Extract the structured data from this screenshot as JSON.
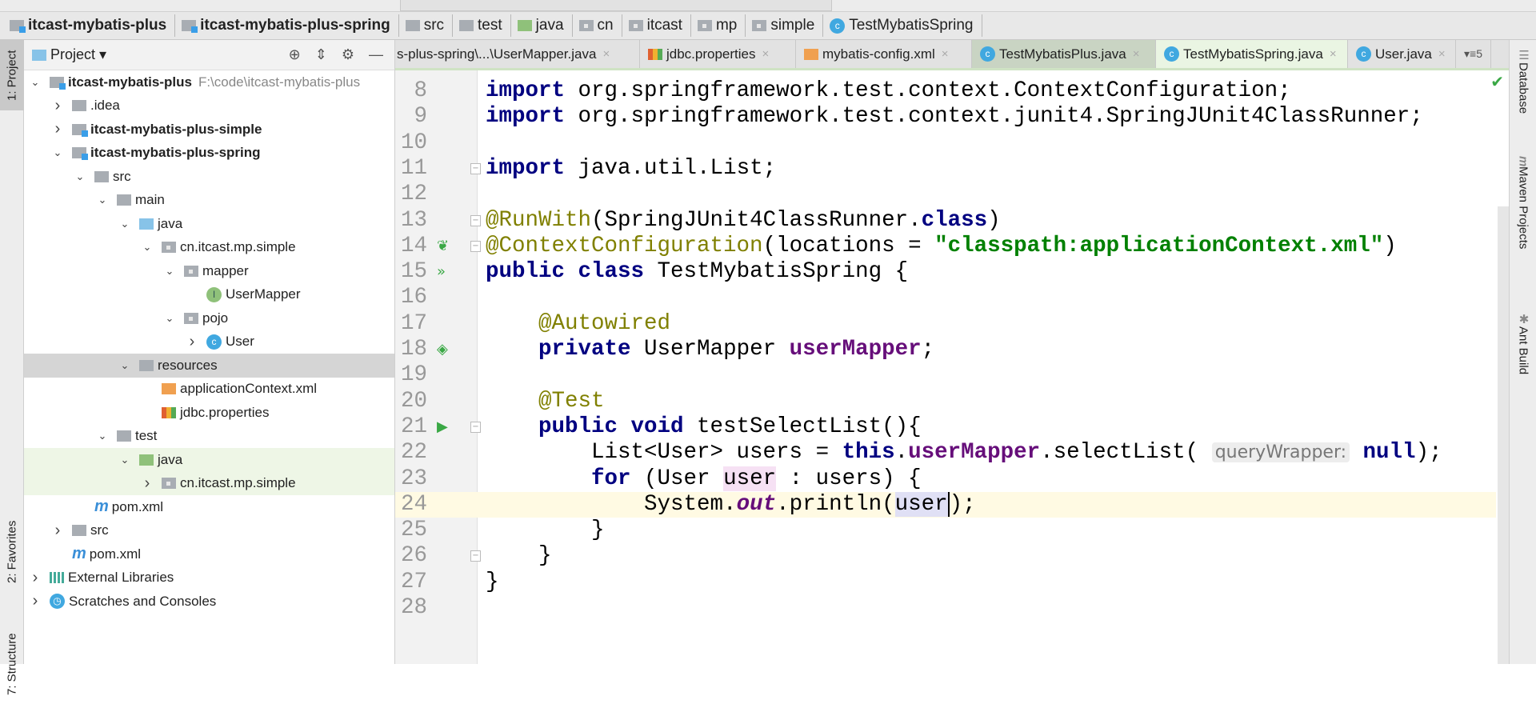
{
  "breadcrumb": [
    {
      "label": "itcast-mybatis-plus",
      "icon": "module-icon",
      "bold": true
    },
    {
      "label": "itcast-mybatis-plus-spring",
      "icon": "module-icon",
      "bold": true
    },
    {
      "label": "src",
      "icon": "folder-icon"
    },
    {
      "label": "test",
      "icon": "folder-icon"
    },
    {
      "label": "java",
      "icon": "test-folder-icon"
    },
    {
      "label": "cn",
      "icon": "package-icon"
    },
    {
      "label": "itcast",
      "icon": "package-icon"
    },
    {
      "label": "mp",
      "icon": "package-icon"
    },
    {
      "label": "simple",
      "icon": "package-icon"
    },
    {
      "label": "TestMybatisSpring",
      "icon": "class-icon"
    }
  ],
  "left_strip": {
    "project": "1: Project",
    "favorites": "2: Favorites",
    "structure": "7: Structure"
  },
  "right_strip": {
    "database": "Database",
    "maven": "Maven Projects",
    "ant": "Ant Build"
  },
  "project_panel": {
    "title": "Project ▾",
    "tree": [
      {
        "level": 0,
        "arrow": "v",
        "icon": "module",
        "label": "itcast-mybatis-plus",
        "bold": true,
        "path": "F:\\code\\itcast-mybatis-plus"
      },
      {
        "level": 1,
        "arrow": ">",
        "icon": "folder",
        "label": ".idea"
      },
      {
        "level": 1,
        "arrow": ">",
        "icon": "module",
        "label": "itcast-mybatis-plus-simple",
        "bold": true
      },
      {
        "level": 1,
        "arrow": "v",
        "icon": "module",
        "label": "itcast-mybatis-plus-spring",
        "bold": true
      },
      {
        "level": 2,
        "arrow": "v",
        "icon": "folder",
        "label": "src"
      },
      {
        "level": 3,
        "arrow": "v",
        "icon": "folder",
        "label": "main"
      },
      {
        "level": 4,
        "arrow": "v",
        "icon": "source",
        "label": "java"
      },
      {
        "level": 5,
        "arrow": "v",
        "icon": "package",
        "label": "cn.itcast.mp.simple"
      },
      {
        "level": 6,
        "arrow": "v",
        "icon": "package",
        "label": "mapper"
      },
      {
        "level": 7,
        "arrow": "",
        "icon": "interface",
        "label": "UserMapper"
      },
      {
        "level": 6,
        "arrow": "v",
        "icon": "package",
        "label": "pojo"
      },
      {
        "level": 7,
        "arrow": ">",
        "icon": "class",
        "label": "User"
      },
      {
        "level": 4,
        "arrow": "v",
        "icon": "resources",
        "label": "resources",
        "highlight": "gray"
      },
      {
        "level": 5,
        "arrow": "",
        "icon": "xml",
        "label": "applicationContext.xml"
      },
      {
        "level": 5,
        "arrow": "",
        "icon": "properties",
        "label": "jdbc.properties"
      },
      {
        "level": 3,
        "arrow": "v",
        "icon": "folder",
        "label": "test"
      },
      {
        "level": 4,
        "arrow": "v",
        "icon": "test",
        "label": "java",
        "highlight": "green"
      },
      {
        "level": 5,
        "arrow": ">",
        "icon": "package",
        "label": "cn.itcast.mp.simple",
        "highlight": "green"
      },
      {
        "level": 2,
        "arrow": "",
        "icon": "maven",
        "label": "pom.xml"
      },
      {
        "level": 1,
        "arrow": ">",
        "icon": "folder",
        "label": "src"
      },
      {
        "level": 1,
        "arrow": "",
        "icon": "maven",
        "label": "pom.xml"
      },
      {
        "level": 0,
        "arrow": ">",
        "icon": "libraries",
        "label": "External Libraries"
      },
      {
        "level": 0,
        "arrow": ">",
        "icon": "scratches",
        "label": "Scratches and Consoles"
      }
    ]
  },
  "tabs": [
    {
      "label": "s-plus-spring\\...\\UserMapper.java",
      "icon": "interface"
    },
    {
      "label": "jdbc.properties",
      "icon": "properties"
    },
    {
      "label": "mybatis-config.xml",
      "icon": "xml"
    },
    {
      "label": "TestMybatisPlus.java",
      "icon": "class",
      "style": "plus"
    },
    {
      "label": "TestMybatisSpring.java",
      "icon": "class",
      "active": true
    },
    {
      "label": "User.java",
      "icon": "class"
    }
  ],
  "tabs_overflow": "▾≡5",
  "editor": {
    "current_line": 24,
    "lines": [
      {
        "n": "8",
        "t": [
          [
            "import",
            "kw"
          ],
          [
            " org.springframework.test.context.",
            ""
          ],
          [
            "ContextConfiguration",
            ""
          ],
          [
            ";",
            ""
          ]
        ]
      },
      {
        "n": "9",
        "t": [
          [
            "import",
            "kw"
          ],
          [
            " org.springframework.test.context.junit4.SpringJUnit4ClassRunner;",
            ""
          ]
        ]
      },
      {
        "n": "10",
        "t": []
      },
      {
        "n": "11",
        "fold": true,
        "t": [
          [
            "import",
            "kw"
          ],
          [
            " java.util.List;",
            ""
          ]
        ]
      },
      {
        "n": "12",
        "t": []
      },
      {
        "n": "13",
        "fold": true,
        "t": [
          [
            "@RunWith",
            "ann"
          ],
          [
            "(SpringJUnit4ClassRunner.",
            ""
          ],
          [
            "class",
            "kw"
          ],
          [
            ")",
            ""
          ]
        ]
      },
      {
        "n": "14",
        "icon": "spring-leaf",
        "fold": true,
        "t": [
          [
            "@ContextConfiguration",
            "ann"
          ],
          [
            "(locations = ",
            ""
          ],
          [
            "\"classpath:applicationContext.xml\"",
            "str"
          ],
          [
            ")",
            ""
          ]
        ]
      },
      {
        "n": "15",
        "icon": "run-all",
        "t": [
          [
            "public class",
            "kw"
          ],
          [
            " TestMybatisSpring {",
            ""
          ]
        ]
      },
      {
        "n": "16",
        "t": []
      },
      {
        "n": "17",
        "t": [
          [
            "    ",
            ""
          ],
          [
            "@Autowired",
            "ann"
          ]
        ]
      },
      {
        "n": "18",
        "icon": "bean",
        "t": [
          [
            "    ",
            ""
          ],
          [
            "private",
            "kw"
          ],
          [
            " UserMapper ",
            ""
          ],
          [
            "userMapper",
            "fld"
          ],
          [
            ";",
            ""
          ]
        ]
      },
      {
        "n": "19",
        "t": []
      },
      {
        "n": "20",
        "t": [
          [
            "    ",
            ""
          ],
          [
            "@Test",
            "ann"
          ]
        ]
      },
      {
        "n": "21",
        "icon": "run",
        "fold": true,
        "t": [
          [
            "    ",
            ""
          ],
          [
            "public void",
            "kw"
          ],
          [
            " testSelectList(){",
            ""
          ]
        ]
      },
      {
        "n": "22",
        "t": [
          [
            "        List<User> users = ",
            ""
          ],
          [
            "this",
            "kw"
          ],
          [
            ".",
            ""
          ],
          [
            "userMapper",
            "fld"
          ],
          [
            ".selectList( ",
            ""
          ],
          [
            "queryWrapper:",
            "hint"
          ],
          [
            " ",
            ""
          ],
          [
            "null",
            "kw"
          ],
          [
            ");",
            ""
          ]
        ]
      },
      {
        "n": "23",
        "t": [
          [
            "        ",
            ""
          ],
          [
            "for",
            "kw"
          ],
          [
            " (User ",
            ""
          ],
          [
            "user",
            "pink"
          ],
          [
            " : users) {",
            ""
          ]
        ]
      },
      {
        "n": "24",
        "t": [
          [
            "            System.",
            ""
          ],
          [
            "out",
            "sfld"
          ],
          [
            ".println(",
            ""
          ],
          [
            "user",
            "sel"
          ],
          [
            ");",
            ""
          ]
        ]
      },
      {
        "n": "25",
        "t": [
          [
            "        }",
            ""
          ]
        ]
      },
      {
        "n": "26",
        "fold": true,
        "t": [
          [
            "    }",
            ""
          ]
        ]
      },
      {
        "n": "27",
        "t": [
          [
            "}",
            ""
          ]
        ]
      },
      {
        "n": "28",
        "t": []
      }
    ]
  },
  "colors": {
    "keyword": "#000080",
    "annotation": "#808000",
    "string": "#008000",
    "field": "#660e7a",
    "run_icon": "#3aa845"
  }
}
